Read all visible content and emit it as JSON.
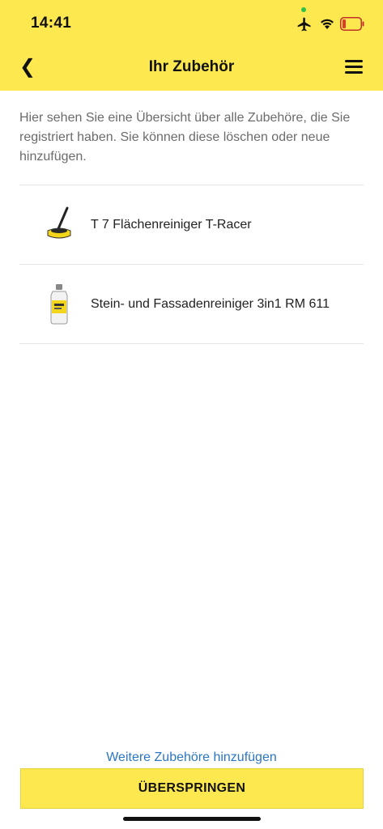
{
  "status_bar": {
    "time": "14:41",
    "icons": [
      "airplane-icon",
      "wifi-icon",
      "battery-low-icon"
    ]
  },
  "header": {
    "title": "Ihr Zubehör",
    "back_icon": "❮",
    "menu_icon": "hamburger-menu-icon"
  },
  "intro_text": "Hier sehen Sie eine Übersicht über alle Zubehöre, die Sie registriert haben. Sie können diese löschen oder neue hinzufügen.",
  "accessories": [
    {
      "name": "T 7 Flächenreiniger T-Racer",
      "icon": "surface-cleaner-image"
    },
    {
      "name": "Stein- und Fassadenreiniger 3in1 RM 611",
      "icon": "cleaner-bottle-image"
    }
  ],
  "footer": {
    "add_link": "Weitere Zubehöre hinzufügen",
    "skip_button": "ÜBERSPRINGEN"
  },
  "colors": {
    "brand_yellow": "#fde94f",
    "link_blue": "#2b76c2"
  }
}
